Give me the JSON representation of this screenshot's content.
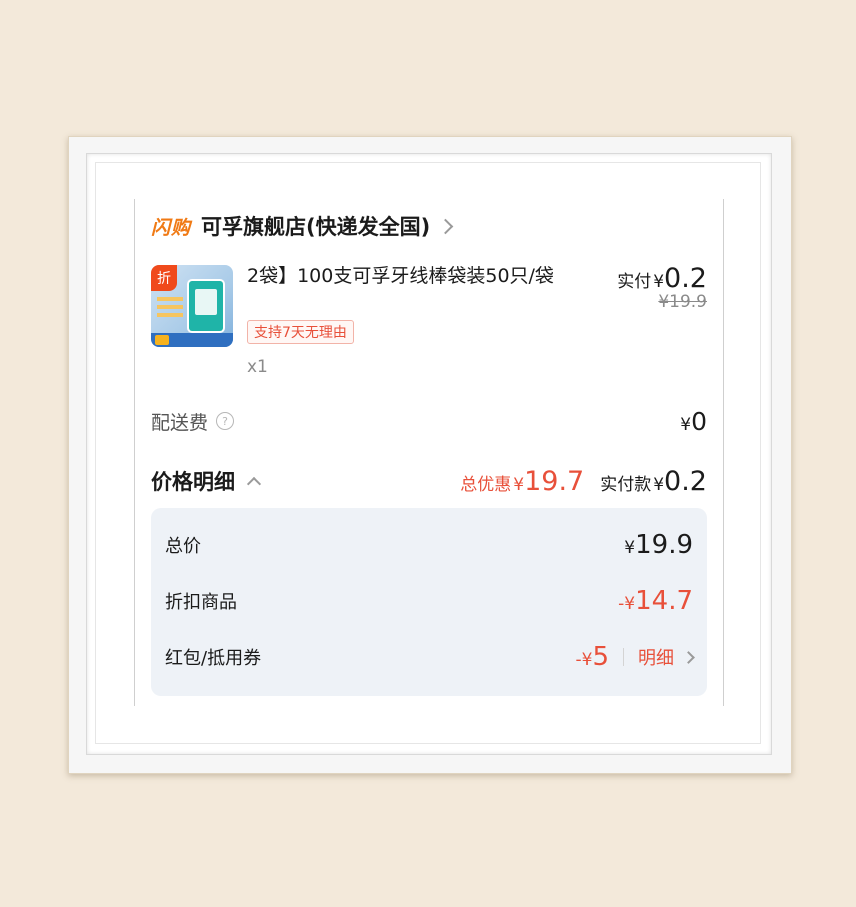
{
  "shop": {
    "tag": "闪购",
    "name": "可孚旗舰店(快递发全国)"
  },
  "product": {
    "thumb_badge": "折",
    "title": "2袋】100支可孚牙线棒袋装50只/袋",
    "guarantee": "支持7天无理由",
    "qty": "x1",
    "paid_label": "实付",
    "currency": "¥",
    "paid_value": "0.2",
    "original_price": "¥19.9"
  },
  "shipping": {
    "label": "配送费",
    "help_icon": "?",
    "currency": "¥",
    "value": "0"
  },
  "detail": {
    "title": "价格明细",
    "discount_label": "总优惠",
    "discount_currency": "¥",
    "discount_value": "19.7",
    "paid_label": "实付款",
    "paid_currency": "¥",
    "paid_value": "0.2"
  },
  "breakdown": {
    "total": {
      "label": "总价",
      "currency": "¥",
      "value": "19.9"
    },
    "discount_goods": {
      "label": "折扣商品",
      "currency": "-¥",
      "value": "14.7"
    },
    "coupon": {
      "label": "红包/抵用券",
      "currency": "-¥",
      "value": "5",
      "link": "明细"
    }
  },
  "colors": {
    "accent_red": "#e8503a",
    "flash_orange": "#f07a15",
    "panel_bg": "#eef2f7",
    "backdrop": "#f3e9da"
  }
}
